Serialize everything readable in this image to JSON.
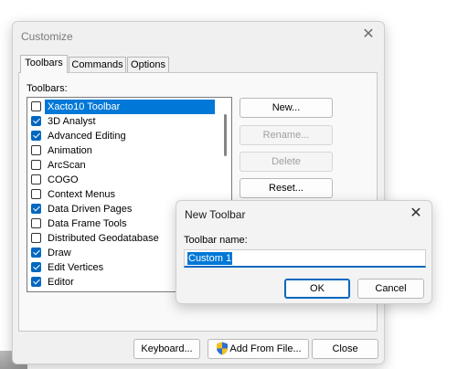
{
  "customize": {
    "title": "Customize",
    "tabs": [
      "Toolbars",
      "Commands",
      "Options"
    ],
    "toolbars_label": "Toolbars:",
    "toolbar_items": [
      {
        "label": "Xacto10 Toolbar",
        "checked": false,
        "selected": true
      },
      {
        "label": "3D Analyst",
        "checked": true
      },
      {
        "label": "Advanced Editing",
        "checked": true
      },
      {
        "label": "Animation",
        "checked": false
      },
      {
        "label": "ArcScan",
        "checked": false
      },
      {
        "label": "COGO",
        "checked": false
      },
      {
        "label": "Context Menus",
        "checked": false
      },
      {
        "label": "Data Driven Pages",
        "checked": true
      },
      {
        "label": "Data Frame Tools",
        "checked": false
      },
      {
        "label": "Distributed Geodatabase",
        "checked": false
      },
      {
        "label": "Draw",
        "checked": true
      },
      {
        "label": "Edit Vertices",
        "checked": true
      },
      {
        "label": "Editor",
        "checked": true
      }
    ],
    "buttons": {
      "new": "New...",
      "rename": "Rename...",
      "delete": "Delete",
      "reset": "Reset..."
    },
    "footer": {
      "keyboard": "Keyboard...",
      "add_from_file": "Add From File...",
      "close": "Close"
    }
  },
  "new_toolbar": {
    "title": "New Toolbar",
    "name_label": "Toolbar name:",
    "name_value": "Custom 1",
    "ok": "OK",
    "cancel": "Cancel"
  },
  "icons": {
    "close": "close-icon",
    "shield": "uac-shield-icon",
    "checkbox": "checkbox-icon"
  }
}
